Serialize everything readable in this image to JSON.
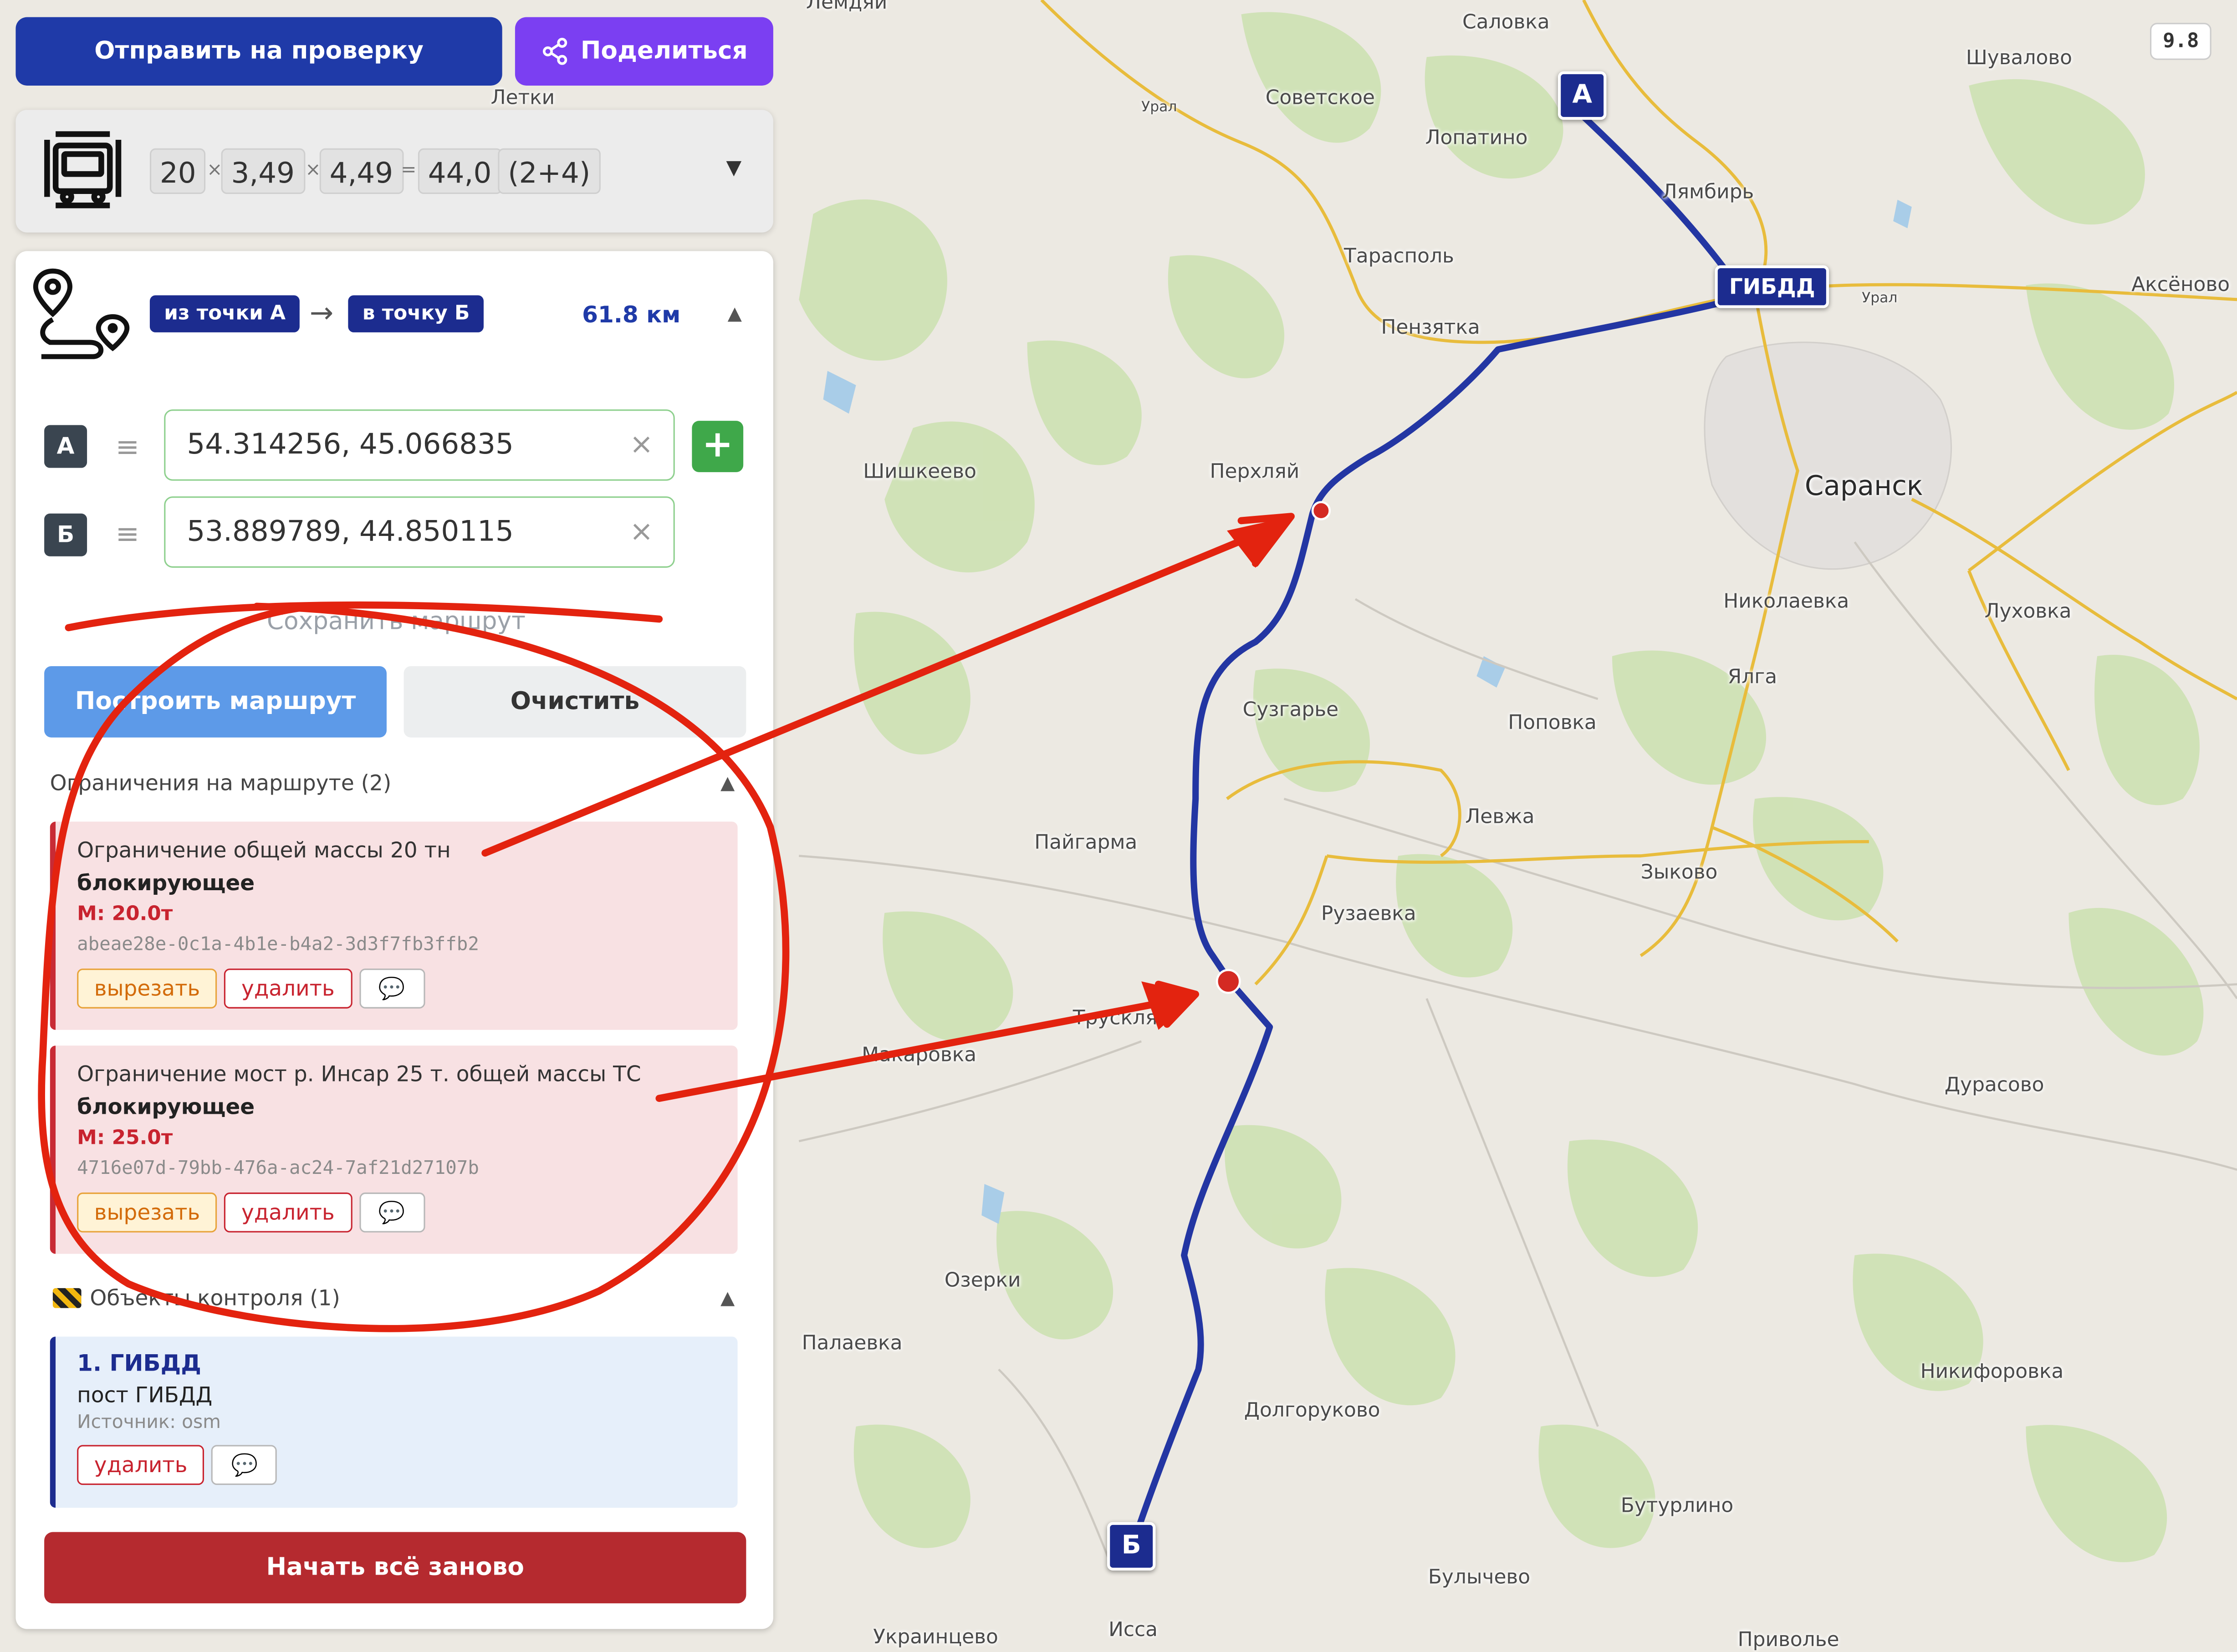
{
  "toolbar": {
    "submit_label": "Отправить на проверку",
    "share_label": "Поделиться"
  },
  "vehicle": {
    "axles": "20",
    "width": "3,49",
    "height": "4,49",
    "total": "44,0",
    "config": "(2+4)",
    "times": "×",
    "equals": "="
  },
  "route": {
    "from_label": "из точки А",
    "arrow": "→",
    "to_label": "в точку Б",
    "distance": "61.8 км",
    "point_a_letter": "А",
    "point_a_value": "54.314256, 45.066835",
    "point_b_letter": "Б",
    "point_b_value": "53.889789, 44.850115",
    "save_label": "Сохранить маршрут",
    "build_label": "Построить маршрут",
    "clear_label": "Очистить"
  },
  "restrictions": {
    "header": "Ограничения на маршруте (2)",
    "items": [
      {
        "title": "Ограничение общей массы 20 тн",
        "type": "блокирующее",
        "mass": "М: 20.0т",
        "id": "abeae28e-0c1a-4b1e-b4a2-3d3f7fb3ffb2",
        "cut": "вырезать",
        "delete": "удалить"
      },
      {
        "title": "Ограничение мост р. Инсар 25 т. общей массы ТС",
        "type": "блокирующее",
        "mass": "М: 25.0т",
        "id": "4716e07d-79bb-476a-ac24-7af21d27107b",
        "cut": "вырезать",
        "delete": "удалить"
      }
    ]
  },
  "control": {
    "header": "Объекты контроля (1)",
    "item_title": "1. ГИБДД",
    "item_sub": "пост ГИБДД",
    "item_source": "Источник: osm",
    "delete": "удалить"
  },
  "restart_label": "Начать всё заново",
  "map": {
    "zoom": "9.8",
    "marker_a": "А",
    "marker_b": "Б",
    "gibdd_marker": "ГИБДД",
    "places": [
      "Лемдяй",
      "Саловка",
      "Советское",
      "Лопатино",
      "Шувалово",
      "Лямбирь",
      "Тарасполь",
      "Пензятка",
      "Аксёново",
      "Шишкеево",
      "Перхляй",
      "Саранск",
      "Николаевка",
      "Луховка",
      "Ялга",
      "Сузгарье",
      "Поповка",
      "Левжа",
      "Пайгарма",
      "Зыково",
      "Рузаевка",
      "Макаровка",
      "Трускляй",
      "Дурасово",
      "Озерки",
      "Палаевка",
      "Никифоровка",
      "Долгоруково",
      "Бутурлино",
      "Булычево",
      "Исса",
      "Украинцево",
      "Приволье",
      "Летки",
      "Урал",
      "Урал"
    ]
  },
  "colors": {
    "route": "#2336a3",
    "primary": "#1f3aa8",
    "share": "#7b3ff2",
    "danger": "#b52a2f",
    "annotation": "#e3230f"
  }
}
